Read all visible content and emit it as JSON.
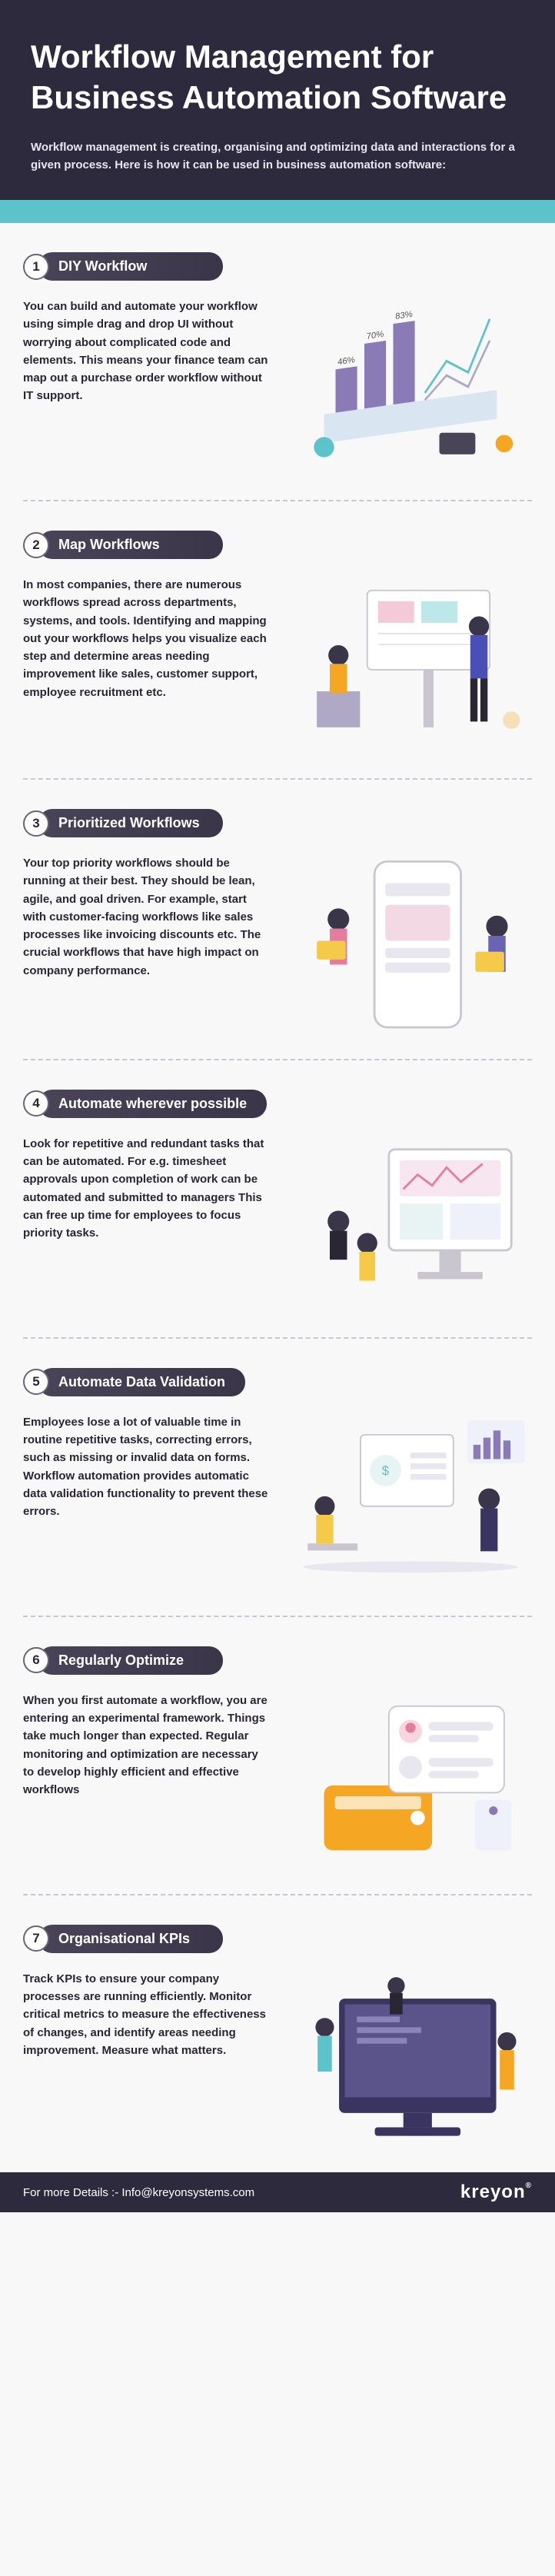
{
  "hero": {
    "title": "Workflow Management for Business Automation Software",
    "lede": "Workflow management is creating, organising and optimizing data and interactions for a given process. Here is how it can be used in business automation software:"
  },
  "sections": [
    {
      "num": "1",
      "title": "DIY Workflow",
      "body": "You can build and automate your workflow using simple drag and drop UI without worrying about complicated code and elements. This means your finance team can map out a purchase order workflow without IT support."
    },
    {
      "num": "2",
      "title": "Map Workflows",
      "body": "In most companies, there are numerous workflows spread across departments, systems, and tools. Identifying and mapping out your workflows helps you visualize each step and determine areas needing improvement like sales, customer support, employee recruitment etc."
    },
    {
      "num": "3",
      "title": "Prioritized Workflows",
      "body": "Your top priority workflows should be running at their best. They should be lean, agile, and goal driven. For example, start with customer-facing workflows like sales processes like invoicing discounts etc. The crucial workflows that have high impact on company performance."
    },
    {
      "num": "4",
      "title": "Automate wherever possible",
      "body": "Look for repetitive and redundant tasks that can be automated. For e.g. timesheet approvals upon completion of work can be automated and submitted to managers This can free up time for employees to focus priority tasks."
    },
    {
      "num": "5",
      "title": "Automate Data Validation",
      "body": "Employees lose a lot of valuable time in routine repetitive tasks, correcting errors, such as missing or invalid data on forms. Workflow automation provides automatic data validation functionality to prevent these errors."
    },
    {
      "num": "6",
      "title": "Regularly Optimize",
      "body": "When you first automate a workflow, you are entering an experimental framework. Things take much longer than expected. Regular monitoring and optimization are necessary to develop highly efficient and effective workflows"
    },
    {
      "num": "7",
      "title": "Organisational KPIs",
      "body": "Track KPIs to ensure your company processes are running efficiently. Monitor critical metrics to measure the effectiveness of changes, and identify areas needing improvement. Measure what matters."
    }
  ],
  "chart_data": {
    "type": "bar",
    "categories": [
      "",
      "",
      ""
    ],
    "values": [
      46,
      70,
      83
    ],
    "labels": [
      "46%",
      "70%",
      "83%"
    ],
    "title": "",
    "xlabel": "",
    "ylabel": "",
    "ylim": [
      0,
      100
    ]
  },
  "footer": {
    "details": "For more Details :- Info@kreyonsystems.com",
    "brand": "kreyon",
    "brand_mark": "®"
  },
  "colors": {
    "bg_dark": "#2d2a3d",
    "teal": "#5bc3c9",
    "purple": "#8a7ab5",
    "blue": "#4a90e2",
    "orange": "#f5a623",
    "pink": "#e57b9e"
  }
}
